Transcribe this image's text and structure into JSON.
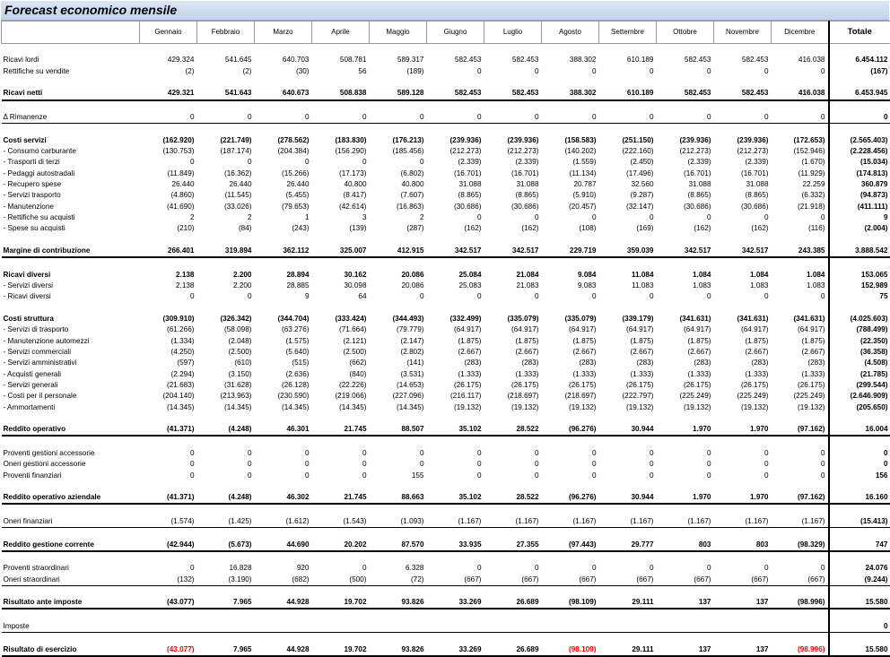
{
  "title": "Forecast economico mensile",
  "headers": [
    "Gennaio",
    "Febbraio",
    "Marzo",
    "Aprile",
    "Maggio",
    "Giugno",
    "Luglio",
    "Agosto",
    "Settembre",
    "Ottobre",
    "Novembre",
    "Dicembre"
  ],
  "total_header": "Totale",
  "rows": [
    {
      "type": "blank"
    },
    {
      "label": "Ricavi lordi",
      "v": [
        "429.324",
        "541.645",
        "640.703",
        "508.781",
        "589.317",
        "582.453",
        "582.453",
        "388.302",
        "610.189",
        "582.453",
        "582.453",
        "416.038"
      ],
      "t": "6.454.112"
    },
    {
      "label": "Rettifiche su vendite",
      "v": [
        "(2)",
        "(2)",
        "(30)",
        "56",
        "(189)",
        "0",
        "0",
        "0",
        "0",
        "0",
        "0",
        "0"
      ],
      "t": "(167)"
    },
    {
      "type": "blank"
    },
    {
      "label": "Ricavi netti",
      "bold": true,
      "border": "thick",
      "v": [
        "429.321",
        "541.643",
        "640.673",
        "508.838",
        "589.128",
        "582.453",
        "582.453",
        "388.302",
        "610.189",
        "582.453",
        "582.453",
        "416.038"
      ],
      "t": "6.453.945"
    },
    {
      "type": "blank"
    },
    {
      "label": "Δ Rimanenze",
      "border": "thin",
      "v": [
        "0",
        "0",
        "0",
        "0",
        "0",
        "0",
        "0",
        "0",
        "0",
        "0",
        "0",
        "0"
      ],
      "t": "0"
    },
    {
      "type": "blank"
    },
    {
      "label": "Costi servizi",
      "bold": true,
      "v": [
        "(162.920)",
        "(221.749)",
        "(278.562)",
        "(183.830)",
        "(176.213)",
        "(239.936)",
        "(239.936)",
        "(158.583)",
        "(251.150)",
        "(239.936)",
        "(239.936)",
        "(172.653)"
      ],
      "t": "(2.565.403)"
    },
    {
      "label": " - Consumo carburante",
      "v": [
        "(130.753)",
        "(187.174)",
        "(204.384)",
        "(156.290)",
        "(185.456)",
        "(212.273)",
        "(212.273)",
        "(140.202)",
        "(222.160)",
        "(212.273)",
        "(212.273)",
        "(152.946)"
      ],
      "t": "(2.228.456)"
    },
    {
      "label": " - Trasporti di terzi",
      "v": [
        "0",
        "0",
        "0",
        "0",
        "0",
        "(2.339)",
        "(2.339)",
        "(1.559)",
        "(2.450)",
        "(2.339)",
        "(2.339)",
        "(1.670)"
      ],
      "t": "(15.034)"
    },
    {
      "label": " - Pedaggi autostradali",
      "v": [
        "(11.849)",
        "(16.362)",
        "(15.266)",
        "(17.173)",
        "(6.802)",
        "(16.701)",
        "(16.701)",
        "(11.134)",
        "(17.496)",
        "(16.701)",
        "(16.701)",
        "(11.929)"
      ],
      "t": "(174.813)"
    },
    {
      "label": " - Recupero spese",
      "v": [
        "26.440",
        "26.440",
        "26.440",
        "40.800",
        "40.800",
        "31.088",
        "31.088",
        "20.787",
        "32.560",
        "31.088",
        "31.088",
        "22.259"
      ],
      "t": "360.879"
    },
    {
      "label": " - Servizi trasporto",
      "v": [
        "(4.860)",
        "(11.545)",
        "(5.455)",
        "(8.417)",
        "(7.607)",
        "(8.865)",
        "(8.865)",
        "(5.910)",
        "(9.287)",
        "(8.865)",
        "(8.865)",
        "(6.332)"
      ],
      "t": "(94.873)"
    },
    {
      "label": " - Manutenzione",
      "v": [
        "(41.690)",
        "(33.026)",
        "(79.653)",
        "(42.614)",
        "(16.863)",
        "(30.686)",
        "(30.686)",
        "(20.457)",
        "(32.147)",
        "(30.686)",
        "(30.686)",
        "(21.918)"
      ],
      "t": "(411.111)"
    },
    {
      "label": " - Rettifiche su acquisti",
      "v": [
        "2",
        "2",
        "1",
        "3",
        "2",
        "0",
        "0",
        "0",
        "0",
        "0",
        "0",
        "0"
      ],
      "t": "9"
    },
    {
      "label": " - Spese su acquisti",
      "v": [
        "(210)",
        "(84)",
        "(243)",
        "(139)",
        "(287)",
        "(162)",
        "(162)",
        "(108)",
        "(169)",
        "(162)",
        "(162)",
        "(116)"
      ],
      "t": "(2.004)"
    },
    {
      "type": "blank"
    },
    {
      "label": "Margine di contribuzione",
      "bold": true,
      "border": "thick",
      "v": [
        "266.401",
        "319.894",
        "362.112",
        "325.007",
        "412.915",
        "342.517",
        "342.517",
        "229.719",
        "359.039",
        "342.517",
        "342.517",
        "243.385"
      ],
      "t": "3.888.542"
    },
    {
      "type": "blank"
    },
    {
      "label": "Ricavi diversi",
      "bold": true,
      "v": [
        "2.138",
        "2.200",
        "28.894",
        "30.162",
        "20.086",
        "25.084",
        "21.084",
        "9.084",
        "11.084",
        "1.084",
        "1.084",
        "1.084"
      ],
      "t": "153.065"
    },
    {
      "label": " - Servizi diversi",
      "v": [
        "2.138",
        "2.200",
        "28.885",
        "30.098",
        "20.086",
        "25.083",
        "21.083",
        "9.083",
        "11.083",
        "1.083",
        "1.083",
        "1.083"
      ],
      "t": "152.989"
    },
    {
      "label": " - Ricavi diversi",
      "v": [
        "0",
        "0",
        "9",
        "64",
        "0",
        "0",
        "0",
        "0",
        "0",
        "0",
        "0",
        "0"
      ],
      "t": "75"
    },
    {
      "type": "blank"
    },
    {
      "label": "Costi struttura",
      "bold": true,
      "v": [
        "(309.910)",
        "(326.342)",
        "(344.704)",
        "(333.424)",
        "(344.493)",
        "(332.499)",
        "(335.079)",
        "(335.079)",
        "(339.179)",
        "(341.631)",
        "(341.631)",
        "(341.631)"
      ],
      "t": "(4.025.603)"
    },
    {
      "label": " - Servizi di trasporto",
      "v": [
        "(61.266)",
        "(58.098)",
        "(63.276)",
        "(71.664)",
        "(79.779)",
        "(64.917)",
        "(64.917)",
        "(64.917)",
        "(64.917)",
        "(64.917)",
        "(64.917)",
        "(64.917)"
      ],
      "t": "(788.499)"
    },
    {
      "label": " - Manutenzione automezzi",
      "v": [
        "(1.334)",
        "(2.048)",
        "(1.575)",
        "(2.121)",
        "(2.147)",
        "(1.875)",
        "(1.875)",
        "(1.875)",
        "(1.875)",
        "(1.875)",
        "(1.875)",
        "(1.875)"
      ],
      "t": "(22.350)"
    },
    {
      "label": " - Servizi commerciali",
      "v": [
        "(4.250)",
        "(2.500)",
        "(5.640)",
        "(2.500)",
        "(2.802)",
        "(2.667)",
        "(2.667)",
        "(2.667)",
        "(2.667)",
        "(2.667)",
        "(2.667)",
        "(2.667)"
      ],
      "t": "(36.358)"
    },
    {
      "label": " - Servizi amministrativi",
      "v": [
        "(597)",
        "(610)",
        "(515)",
        "(662)",
        "(141)",
        "(283)",
        "(283)",
        "(283)",
        "(283)",
        "(283)",
        "(283)",
        "(283)"
      ],
      "t": "(4.508)"
    },
    {
      "label": " - Acquisti generali",
      "v": [
        "(2.294)",
        "(3.150)",
        "(2.636)",
        "(840)",
        "(3.531)",
        "(1.333)",
        "(1.333)",
        "(1.333)",
        "(1.333)",
        "(1.333)",
        "(1.333)",
        "(1.333)"
      ],
      "t": "(21.785)"
    },
    {
      "label": " - Servizi generali",
      "v": [
        "(21.683)",
        "(31.628)",
        "(26.128)",
        "(22.226)",
        "(14.653)",
        "(26.175)",
        "(26.175)",
        "(26.175)",
        "(26.175)",
        "(26.175)",
        "(26.175)",
        "(26.175)"
      ],
      "t": "(299.544)"
    },
    {
      "label": " - Costi per il personale",
      "v": [
        "(204.140)",
        "(213.963)",
        "(230.590)",
        "(219.066)",
        "(227.096)",
        "(216.117)",
        "(218.697)",
        "(218.697)",
        "(222.797)",
        "(225.249)",
        "(225.249)",
        "(225.249)"
      ],
      "t": "(2.646.909)"
    },
    {
      "label": " - Ammortamenti",
      "v": [
        "(14.345)",
        "(14.345)",
        "(14.345)",
        "(14.345)",
        "(14.345)",
        "(19.132)",
        "(19.132)",
        "(19.132)",
        "(19.132)",
        "(19.132)",
        "(19.132)",
        "(19.132)"
      ],
      "t": "(205.650)"
    },
    {
      "type": "blank"
    },
    {
      "label": "Reddito operativo",
      "bold": true,
      "border": "thick",
      "v": [
        "(41.371)",
        "(4.248)",
        "46.301",
        "21.745",
        "88.507",
        "35.102",
        "28.522",
        "(96.276)",
        "30.944",
        "1.970",
        "1.970",
        "(97.162)"
      ],
      "t": "16.004"
    },
    {
      "type": "blank"
    },
    {
      "label": "Proventi gestioni accessorie",
      "v": [
        "0",
        "0",
        "0",
        "0",
        "0",
        "0",
        "0",
        "0",
        "0",
        "0",
        "0",
        "0"
      ],
      "t": "0"
    },
    {
      "label": "Oneri gestioni accessorie",
      "v": [
        "0",
        "0",
        "0",
        "0",
        "0",
        "0",
        "0",
        "0",
        "0",
        "0",
        "0",
        "0"
      ],
      "t": "0"
    },
    {
      "label": "Proventi finanziari",
      "v": [
        "0",
        "0",
        "0",
        "0",
        "155",
        "0",
        "0",
        "0",
        "0",
        "0",
        "0",
        "0"
      ],
      "t": "156"
    },
    {
      "type": "blank"
    },
    {
      "label": "Reddito operativo aziendale",
      "bold": true,
      "border": "thick",
      "v": [
        "(41.371)",
        "(4.248)",
        "46.302",
        "21.745",
        "88.663",
        "35.102",
        "28.522",
        "(96.276)",
        "30.944",
        "1.970",
        "1.970",
        "(97.162)"
      ],
      "t": "16.160"
    },
    {
      "type": "blank"
    },
    {
      "label": "Oneri finanziari",
      "border": "thin",
      "v": [
        "(1.574)",
        "(1.425)",
        "(1.612)",
        "(1.543)",
        "(1.093)",
        "(1.167)",
        "(1.167)",
        "(1.167)",
        "(1.167)",
        "(1.167)",
        "(1.167)",
        "(1.167)"
      ],
      "t": "(15.413)"
    },
    {
      "type": "blank"
    },
    {
      "label": "Reddito gestione corrente",
      "bold": true,
      "border": "thick",
      "v": [
        "(42.944)",
        "(5.673)",
        "44.690",
        "20.202",
        "87.570",
        "33.935",
        "27.355",
        "(97.443)",
        "29.777",
        "803",
        "803",
        "(98.329)"
      ],
      "t": "747"
    },
    {
      "type": "blank"
    },
    {
      "label": "Proventi straordinari",
      "v": [
        "0",
        "16.828",
        "920",
        "0",
        "6.328",
        "0",
        "0",
        "0",
        "0",
        "0",
        "0",
        "0"
      ],
      "t": "24.076"
    },
    {
      "label": "Oneri straordinari",
      "border": "thin",
      "v": [
        "(132)",
        "(3.190)",
        "(682)",
        "(500)",
        "(72)",
        "(667)",
        "(667)",
        "(667)",
        "(667)",
        "(667)",
        "(667)",
        "(667)"
      ],
      "t": "(9.244)"
    },
    {
      "type": "blank"
    },
    {
      "label": "Risultato ante imposte",
      "bold": true,
      "border": "thick",
      "v": [
        "(43.077)",
        "7.965",
        "44.928",
        "19.702",
        "93.826",
        "33.269",
        "26.689",
        "(98.109)",
        "29.111",
        "137",
        "137",
        "(98.996)"
      ],
      "t": "15.580"
    },
    {
      "type": "blank"
    },
    {
      "label": "Imposte",
      "border": "thin",
      "v": [
        "",
        "",
        "",
        "",
        "",
        "",
        "",
        "",
        "",
        "",
        "",
        ""
      ],
      "t": "0"
    },
    {
      "type": "blank"
    },
    {
      "label": "Risultato di esercizio",
      "bold": true,
      "border": "thick",
      "redneg": true,
      "v": [
        "(43.077)",
        "7.965",
        "44.928",
        "19.702",
        "93.826",
        "33.269",
        "26.689",
        "(98.109)",
        "29.111",
        "137",
        "137",
        "(98.996)"
      ],
      "t": "15.580"
    }
  ],
  "colors": {
    "negative_result": "#ff0000",
    "title_background": "#c6d6ec",
    "grid": "#9a9a9a"
  }
}
